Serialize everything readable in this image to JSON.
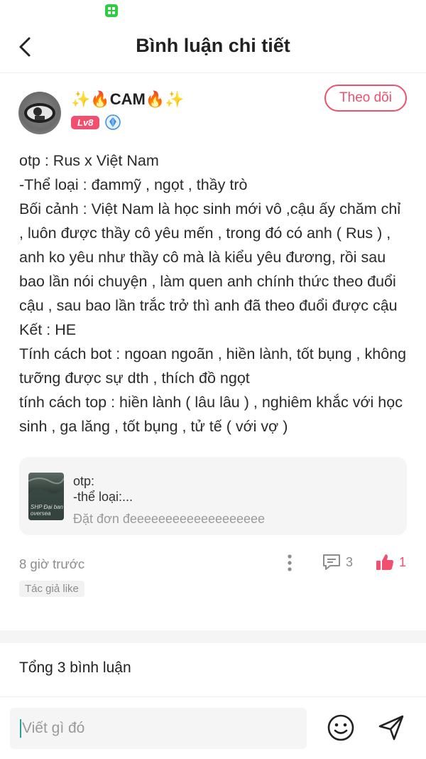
{
  "statusbar": {
    "app_icon": "app-icon"
  },
  "header": {
    "title": "Bình luận chi tiết",
    "back_icon": "chevron-left-icon"
  },
  "author": {
    "name": "✨🔥CAM🔥✨",
    "level": "Lv8",
    "gem_icon": "gem-icon",
    "follow_label": "Theo dõi"
  },
  "content": {
    "lines": [
      "otp : Rus x Việt Nam",
      "-Thể loại : đammỹ , ngọt , thầy trò",
      "Bối cảnh : Việt Nam là học sinh mới vô ,cậu ấy chăm chỉ , luôn được thầy cô yêu mến , trong đó có anh ( Rus ) , anh ko yêu như thầy cô mà là kiểu yêu đương, rồi sau bao lần nói chuyện , làm quen anh chính thức theo đuổi cậu , sau bao lần trắc trở thì anh đã theo đuổi được cậu",
      "Kết : HE",
      "Tính cách bot : ngoan ngoãn , hiền lành, tốt bụng , không tưỡng được sự dth , thích đồ ngọt",
      "tính cách top : hiền lành ( lâu lâu ) , nghiêm khắc với học sinh , ga lăng , tốt bụng , tử tế ( với vợ )"
    ]
  },
  "story_card": {
    "line1": "otp:",
    "line2": "-thể loại:...",
    "line3": "Đặt đơn đeeeeeeeeeeeeeeeeeee",
    "cover_text": "SHP Đại ban\noversea"
  },
  "meta": {
    "time": "8 giờ trước",
    "comment_count": "3",
    "like_count": "1",
    "author_like": "Tác giả like",
    "accent": "#f0506e"
  },
  "comments": {
    "total": "Tổng 3 bình luận"
  },
  "input": {
    "placeholder": "Viết gì đó"
  }
}
